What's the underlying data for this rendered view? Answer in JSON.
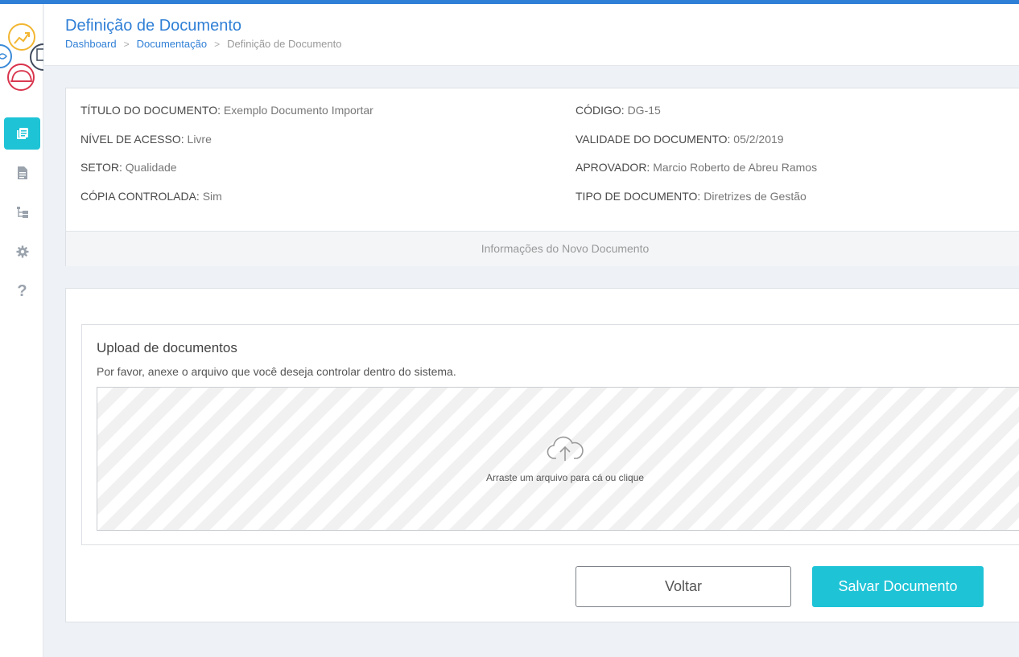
{
  "header": {
    "title": "Definição de Documento",
    "breadcrumb": {
      "dashboard": "Dashboard",
      "documentacao": "Documentação",
      "current": "Definição de Documento",
      "separator": ">"
    }
  },
  "sidebar": {
    "items": [
      {
        "icon": "documents-icon",
        "active": true
      },
      {
        "icon": "file-icon",
        "active": false
      },
      {
        "icon": "tree-icon",
        "active": false
      },
      {
        "icon": "gear-icon",
        "active": false
      },
      {
        "icon": "help-icon",
        "label": "?",
        "active": false
      }
    ]
  },
  "info": {
    "titulo": {
      "label": "TÍTULO DO DOCUMENTO:",
      "value": "Exemplo Documento Importar"
    },
    "nivel": {
      "label": "NÍVEL DE ACESSO:",
      "value": "Livre"
    },
    "setor": {
      "label": "SETOR:",
      "value": "Qualidade"
    },
    "copia": {
      "label": "CÓPIA CONTROLADA:",
      "value": "Sim"
    },
    "codigo": {
      "label": "CÓDIGO:",
      "value": "DG-15"
    },
    "validade": {
      "label": "VALIDADE DO DOCUMENTO:",
      "value": "05/2/2019"
    },
    "aprovador": {
      "label": "APROVADOR:",
      "value": "Marcio Roberto de Abreu Ramos"
    },
    "tipo": {
      "label": "TIPO DE DOCUMENTO:",
      "value": "Diretrizes de Gestão"
    },
    "footer": "Informações do Novo Documento"
  },
  "upload": {
    "title": "Upload de documentos",
    "description": "Por favor, anexe o arquivo que você deseja controlar dentro do sistema.",
    "dropzone_text": "Arraste um arquivo para cá ou clique"
  },
  "actions": {
    "back_label": "Voltar",
    "save_label": "Salvar Documento"
  },
  "colors": {
    "accent": "#2f7fd6",
    "primary_button": "#1ec3d6",
    "logo_yellow": "#f2b632",
    "logo_red": "#d9344c",
    "logo_blue": "#3a8ad8",
    "logo_navy": "#3f4a5c"
  }
}
